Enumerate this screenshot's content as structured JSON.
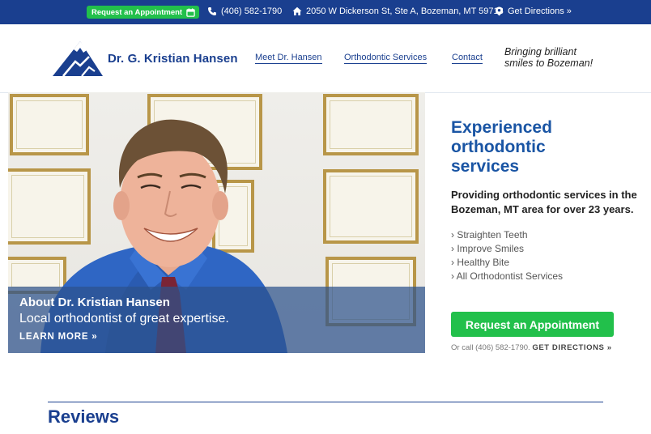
{
  "topbar": {
    "appointment_label": "Request an Appointment",
    "phone": "(406) 582-1790",
    "address": "2050 W Dickerson St, Ste A, Bozeman, MT 59718",
    "directions": "Get Directions »",
    "bg_color": "#1a3f8f",
    "accent_color": "#22c04b"
  },
  "header": {
    "logo_name": "Dr. G. Kristian Hansen",
    "nav": [
      "Meet Dr. Hansen",
      "Orthodontic Services",
      "Contact"
    ],
    "tagline_line1": "Bringing brilliant",
    "tagline_line2": "smiles to Bozeman!"
  },
  "hero": {
    "title": "About Dr. Kristian Hansen",
    "subtitle": "Local orthodontist of great expertise.",
    "link": "LEARN MORE »"
  },
  "services": {
    "title_lines": [
      "Experienced",
      "orthodontic",
      "services"
    ],
    "lead": "Providing orthodontic services in the Bozeman, MT area for over 23 years.",
    "list": [
      "› Straighten Teeth",
      "› Improve Smiles",
      "› Healthy Bite",
      "› All Orthodontist Services"
    ],
    "cta": "Request an Appointment",
    "call_prefix": "Or call (406) 582-1790.",
    "call_directions": "GET DIRECTIONS »"
  },
  "reviews": {
    "heading": "Reviews"
  }
}
